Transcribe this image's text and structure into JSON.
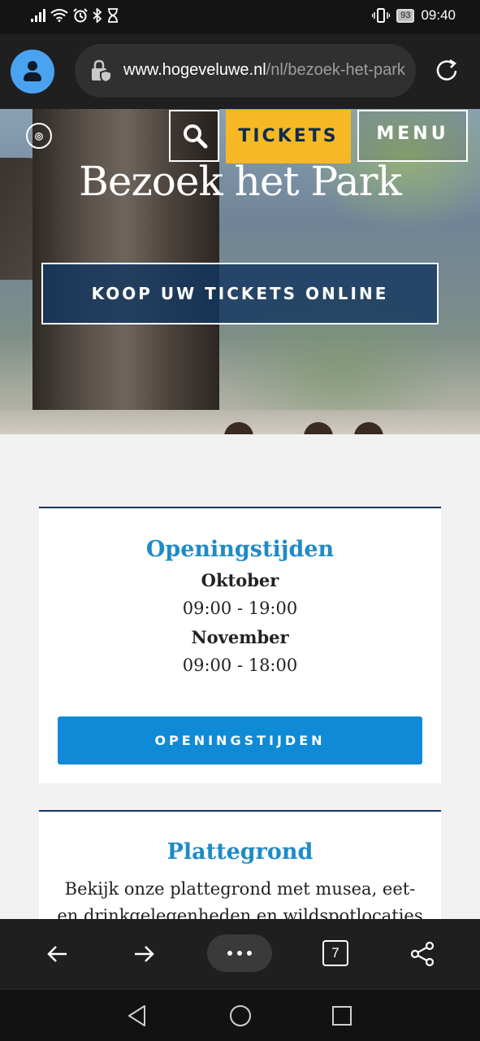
{
  "status_bar": {
    "time": "09:40",
    "battery": "93",
    "left_icons": [
      "signal-icon",
      "wifi-icon",
      "alarm-icon",
      "bluetooth-icon",
      "hourglass-icon"
    ],
    "right_icons": [
      "vibrate-icon",
      "battery-icon"
    ]
  },
  "browser": {
    "url_host": "www.hogeveluwe.nl",
    "url_path": "/nl/bezoek-het-park",
    "tab_count": "7"
  },
  "hero": {
    "title": "Bezoek het Park",
    "tickets_label": "TICKETS",
    "menu_label": "MENU",
    "buy_button": "KOOP UW TICKETS ONLINE"
  },
  "cards": {
    "hours": {
      "title": "Openingstijden",
      "month1": "Oktober",
      "hours1": "09:00 - 19:00",
      "month2": "November",
      "hours2": "09:00 - 18:00",
      "button": "OPENINGSTIJDEN"
    },
    "map": {
      "title": "Plattegrond",
      "text": "Bekijk onze plattegrond met musea, eet- en drinkgelegenheden en wildspotlocaties"
    }
  },
  "colors": {
    "accent_blue": "#0f8ad6",
    "title_blue": "#1f8bc8",
    "tickets_yellow": "#f6b923",
    "navy": "#15375f"
  }
}
